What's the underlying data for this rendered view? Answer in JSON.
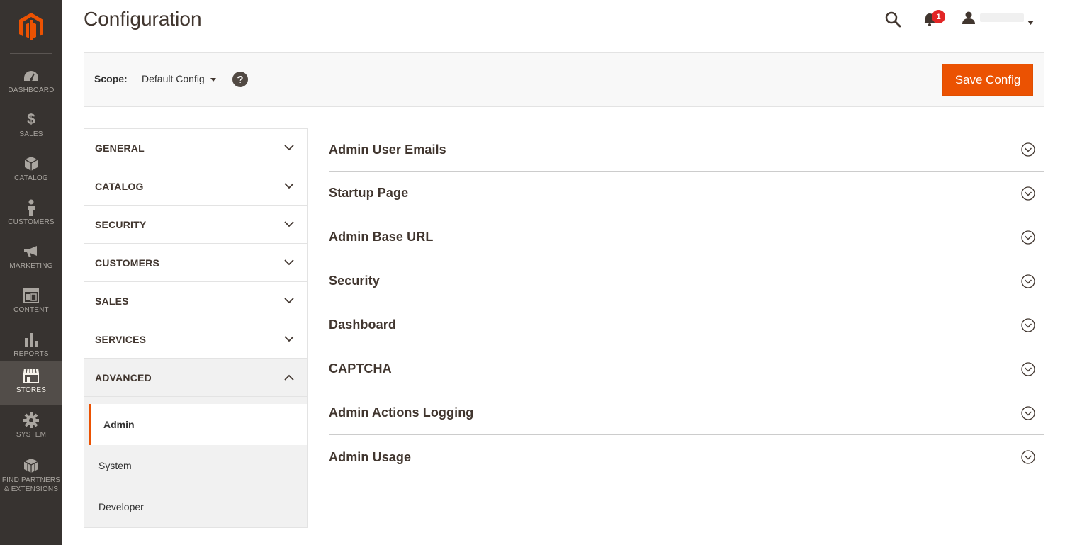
{
  "nav": {
    "items": [
      {
        "label": "DASHBOARD",
        "icon": "dashboard-icon"
      },
      {
        "label": "SALES",
        "icon": "dollar-icon"
      },
      {
        "label": "CATALOG",
        "icon": "box-icon"
      },
      {
        "label": "CUSTOMERS",
        "icon": "person-icon"
      },
      {
        "label": "MARKETING",
        "icon": "megaphone-icon"
      },
      {
        "label": "CONTENT",
        "icon": "layout-icon"
      },
      {
        "label": "REPORTS",
        "icon": "bar-chart-icon"
      },
      {
        "label": "STORES",
        "icon": "store-icon"
      },
      {
        "label": "SYSTEM",
        "icon": "gear-icon"
      },
      {
        "label_line1": "FIND PARTNERS",
        "label_line2": "& EXTENSIONS",
        "icon": "cubes-icon"
      }
    ],
    "active": "STORES",
    "colors": {
      "background": "#373330",
      "active_bg": "#524d49",
      "logo": "#eb5202"
    }
  },
  "header": {
    "title": "Configuration",
    "notifications_count": "1"
  },
  "scope": {
    "label": "Scope:",
    "value": "Default Config",
    "help": "?",
    "save_label": "Save Config"
  },
  "tabs": [
    {
      "label": "GENERAL"
    },
    {
      "label": "CATALOG"
    },
    {
      "label": "SECURITY"
    },
    {
      "label": "CUSTOMERS"
    },
    {
      "label": "SALES"
    },
    {
      "label": "SERVICES"
    },
    {
      "label": "ADVANCED"
    }
  ],
  "advanced_items": [
    {
      "label": "Admin"
    },
    {
      "label": "System"
    },
    {
      "label": "Developer"
    }
  ],
  "sections": [
    {
      "title": "Admin User Emails"
    },
    {
      "title": "Startup Page"
    },
    {
      "title": "Admin Base URL"
    },
    {
      "title": "Security"
    },
    {
      "title": "Dashboard"
    },
    {
      "title": "CAPTCHA"
    },
    {
      "title": "Admin Actions Logging"
    },
    {
      "title": "Admin Usage"
    }
  ],
  "accent_color": "#eb5202"
}
